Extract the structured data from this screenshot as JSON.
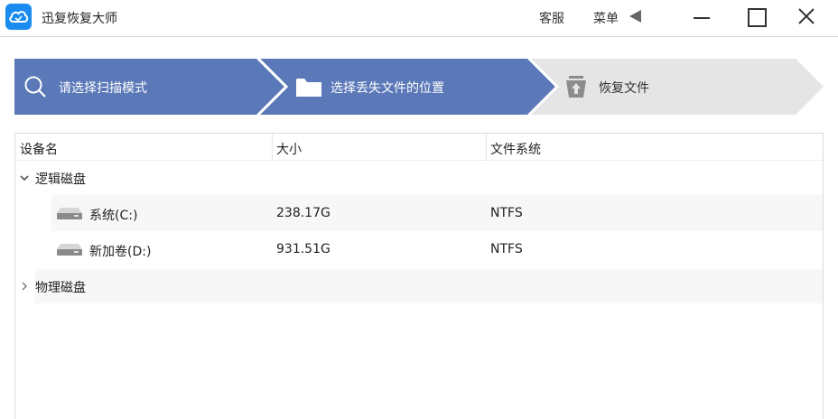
{
  "app": {
    "title": "迅复恢复大师",
    "service_label": "客服",
    "menu_label": "菜单"
  },
  "steps": [
    {
      "label": "请选择扫描模式",
      "icon": "search-icon",
      "state": "done"
    },
    {
      "label": "选择丢失文件的位置",
      "icon": "folder-icon",
      "state": "active"
    },
    {
      "label": "恢复文件",
      "icon": "upload-icon",
      "state": "pending"
    }
  ],
  "colors": {
    "step_active": "#5b78b8",
    "step_pending": "#e5e5e5",
    "accent": "#1a8cf0"
  },
  "table": {
    "columns": [
      "设备名",
      "大小",
      "文件系统"
    ],
    "groups": [
      {
        "label": "逻辑磁盘",
        "expanded": true,
        "rows": [
          {
            "name": "系统(C:)",
            "size": "238.17G",
            "fs": "NTFS"
          },
          {
            "name": "新加卷(D:)",
            "size": "931.51G",
            "fs": "NTFS"
          }
        ]
      },
      {
        "label": "物理磁盘",
        "expanded": false,
        "rows": []
      }
    ]
  }
}
